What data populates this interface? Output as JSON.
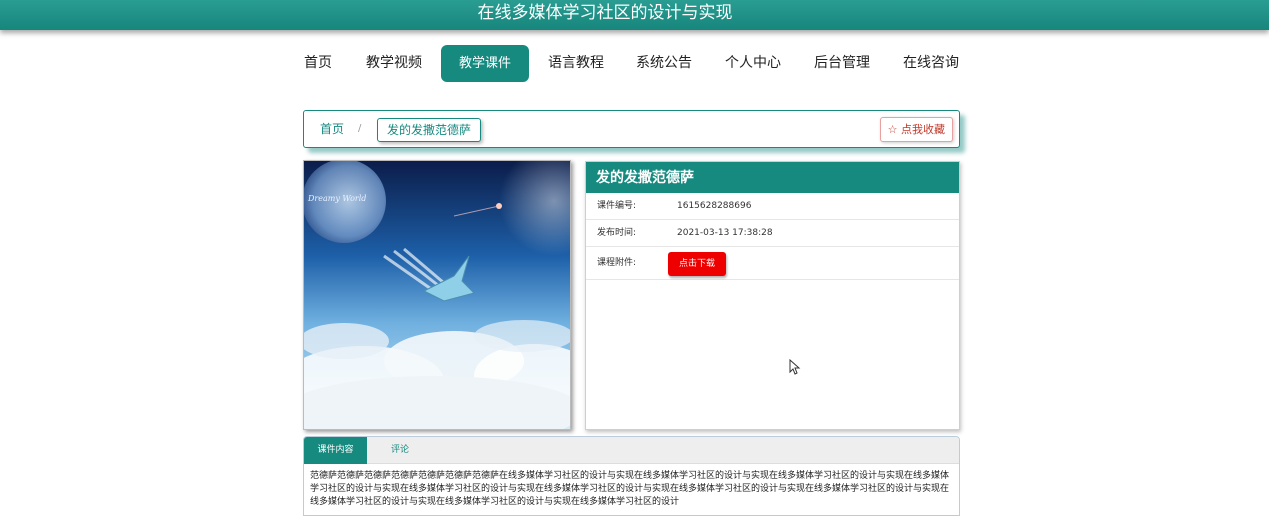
{
  "header": {
    "site_title": "在线多媒体学习社区的设计与实现"
  },
  "nav": {
    "items": [
      {
        "label": "首页"
      },
      {
        "label": "教学视频"
      },
      {
        "label": "教学课件"
      },
      {
        "label": "语言教程"
      },
      {
        "label": "系统公告"
      },
      {
        "label": "个人中心"
      },
      {
        "label": "后台管理"
      },
      {
        "label": "在线咨询"
      }
    ],
    "active_index": 2
  },
  "breadcrumb": {
    "home": "首页",
    "separator": "/",
    "current": "发的发撒范德萨"
  },
  "favorite_button": {
    "label": "☆ 点我收藏"
  },
  "cover_image": {
    "watermark": "Dreamy World"
  },
  "courseware": {
    "title": "发的发撒范德萨",
    "fields": [
      {
        "label": "课件编号:",
        "value": "1615628288696"
      },
      {
        "label": "发布时间:",
        "value": "2021-03-13 17:38:28"
      }
    ],
    "attachment_label": "课程附件:",
    "download_label": "点击下载"
  },
  "tabs": [
    {
      "label": "课件内容"
    },
    {
      "label": "评论"
    }
  ],
  "content": {
    "text": "范德萨范德萨范德萨范德萨范德萨范德萨范德萨在线多媒体学习社区的设计与实现在线多媒体学习社区的设计与实现在线多媒体学习社区的设计与实现在线多媒体学习社区的设计与实现在线多媒体学习社区的设计与实现在线多媒体学习社区的设计与实现在线多媒体学习社区的设计与实现在线多媒体学习社区的设计与实现在线多媒体学习社区的设计与实现在线多媒体学习社区的设计与实现在线多媒体学习社区的设计"
  },
  "colors": {
    "primary": "#178a80",
    "download": "#ee0000",
    "favorite": "#c0392b"
  }
}
